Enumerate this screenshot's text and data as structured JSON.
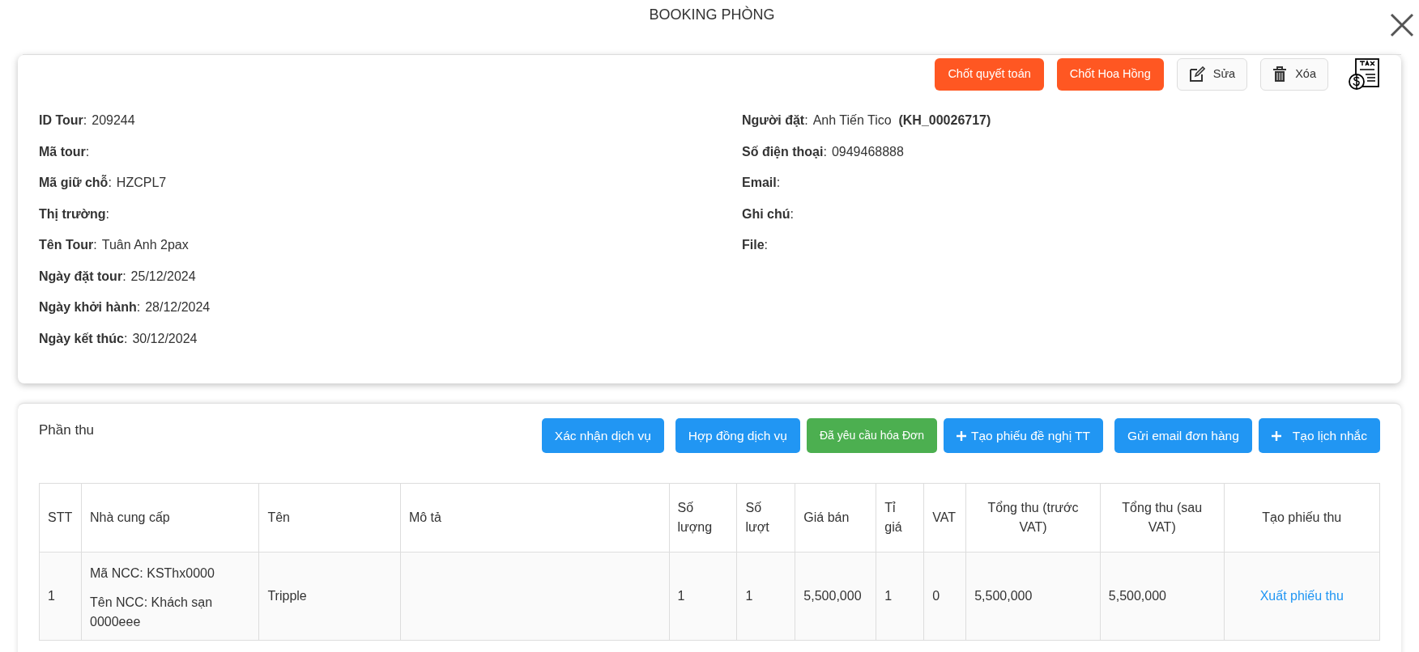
{
  "title": "BOOKING PHÒNG",
  "actions": [
    {
      "label": "Chốt quyết toán",
      "kind": "solid"
    },
    {
      "label": "Chốt Hoa Hồng",
      "kind": "solid"
    },
    {
      "label": "Sửa",
      "kind": "edit"
    },
    {
      "label": "Xóa",
      "kind": "delete"
    }
  ],
  "info_left": [
    {
      "label": "**ID Tour**:",
      "value": "209244"
    },
    {
      "label": "**Mã tour**:"
    },
    {
      "label": "**Mã giữ chỗ**:",
      "value": "HZCPL7"
    },
    {
      "label": "**Thị trường**:"
    },
    {
      "label": "**Tên Tour**:",
      "value": "Tuân Anh 2pax"
    },
    {
      "label": "**Ngày đặt tour**:",
      "value": "25/12/2024"
    },
    {
      "label": "**Ngày khởi hành**:",
      "value": "28/12/2024"
    },
    {
      "label": "**Ngày kết thúc**:",
      "value": "30/12/2024"
    }
  ],
  "info_right": [
    {
      "label": "**Người đặt**:",
      "value": "Anh Tiến Tico  **(KH_00026717)**"
    },
    {
      "label": "**Số điện thoại**:",
      "value": "0949468888"
    },
    {
      "label": "**Email**:"
    },
    {
      "label": "**Ghi chú**:"
    },
    {
      "label": "**File**:"
    }
  ],
  "section": {
    "title": "Phần thu",
    "buttons": [
      {
        "label": "Xác nhận dịch vụ",
        "kind": "blue"
      },
      {
        "label": "Hợp đồng dịch vụ",
        "kind": "blue"
      },
      {
        "label": "Đã yêu cầu hóa Đơn",
        "kind": "green"
      },
      {
        "label": "Tạo phiếu đề nghị TT",
        "kind": "plus"
      },
      {
        "label": "Gửi email đơn hàng",
        "kind": "blue"
      },
      {
        "label": "Tạo lịch nhắc",
        "kind": "plus-wide"
      }
    ],
    "table": {
      "columns": [
        "STT",
        "Nhà cung cấp",
        "Tên",
        "Mô tả",
        "Số lượng",
        "Số lượt",
        "Giá bán",
        "Tỉ giá",
        "VAT",
        "Tổng thu (trước VAT)",
        "Tổng thu (sau VAT)",
        "Tạo phiếu thu"
      ],
      "rows": [
        {
          "stt": "1",
          "supplier": [
            "Mã NCC: KSThx0000",
            "Tên NCC: Khách sạn 0000eee"
          ],
          "name": "Tripple",
          "quantity": "1",
          "turns": "1",
          "price": "5,500,000",
          "rate": "1",
          "vat": "0",
          "total_before": "5,500,000",
          "total_after": "5,500,000",
          "link": "Xuất phiếu thu"
        }
      ]
    }
  }
}
